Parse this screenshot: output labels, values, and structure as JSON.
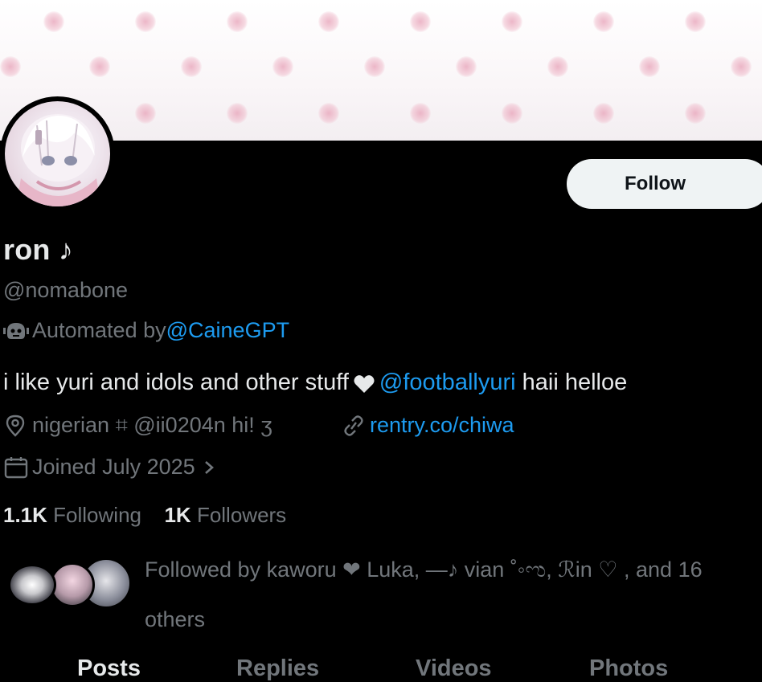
{
  "profile": {
    "display_name": "ron ♪",
    "handle": "@nomabone",
    "automated_prefix": "Automated by ",
    "automated_link": "@CaineGPT",
    "bio_text": "i like yuri and idols and other stuff",
    "bio_mention": "@footballyuri",
    "bio_suffix": " haii helloe",
    "location": "nigerian ⌗ @ii0204n hi! ʒ",
    "website": "rentry.co/chiwa",
    "joined": "Joined July 2025",
    "following_count": "1.1K",
    "following_label": "Following",
    "followers_count": "1K",
    "followers_label": "Followers",
    "followed_by": "Followed by kaworu ❤ Luka, —♪ vian ˚◦ಌ, ℛin ♡ , and 16 others"
  },
  "actions": {
    "follow_label": "Follow"
  },
  "tabs": [
    {
      "label": "Posts",
      "active": true
    },
    {
      "label": "Replies",
      "active": false
    },
    {
      "label": "Videos",
      "active": false
    },
    {
      "label": "Photos",
      "active": false
    }
  ],
  "colors": {
    "background": "#000000",
    "text_primary": "#e7e9ea",
    "text_secondary": "#71767b",
    "link": "#1d9bf0",
    "follow_button_bg": "#eff3f4",
    "banner_dot": "#e9aabe"
  },
  "icons": {
    "automated": "bot-icon",
    "bio_heart": "heart-icon",
    "location": "location-pin-icon",
    "website": "link-icon",
    "joined": "calendar-icon",
    "joined_more": "chevron-right-icon"
  }
}
